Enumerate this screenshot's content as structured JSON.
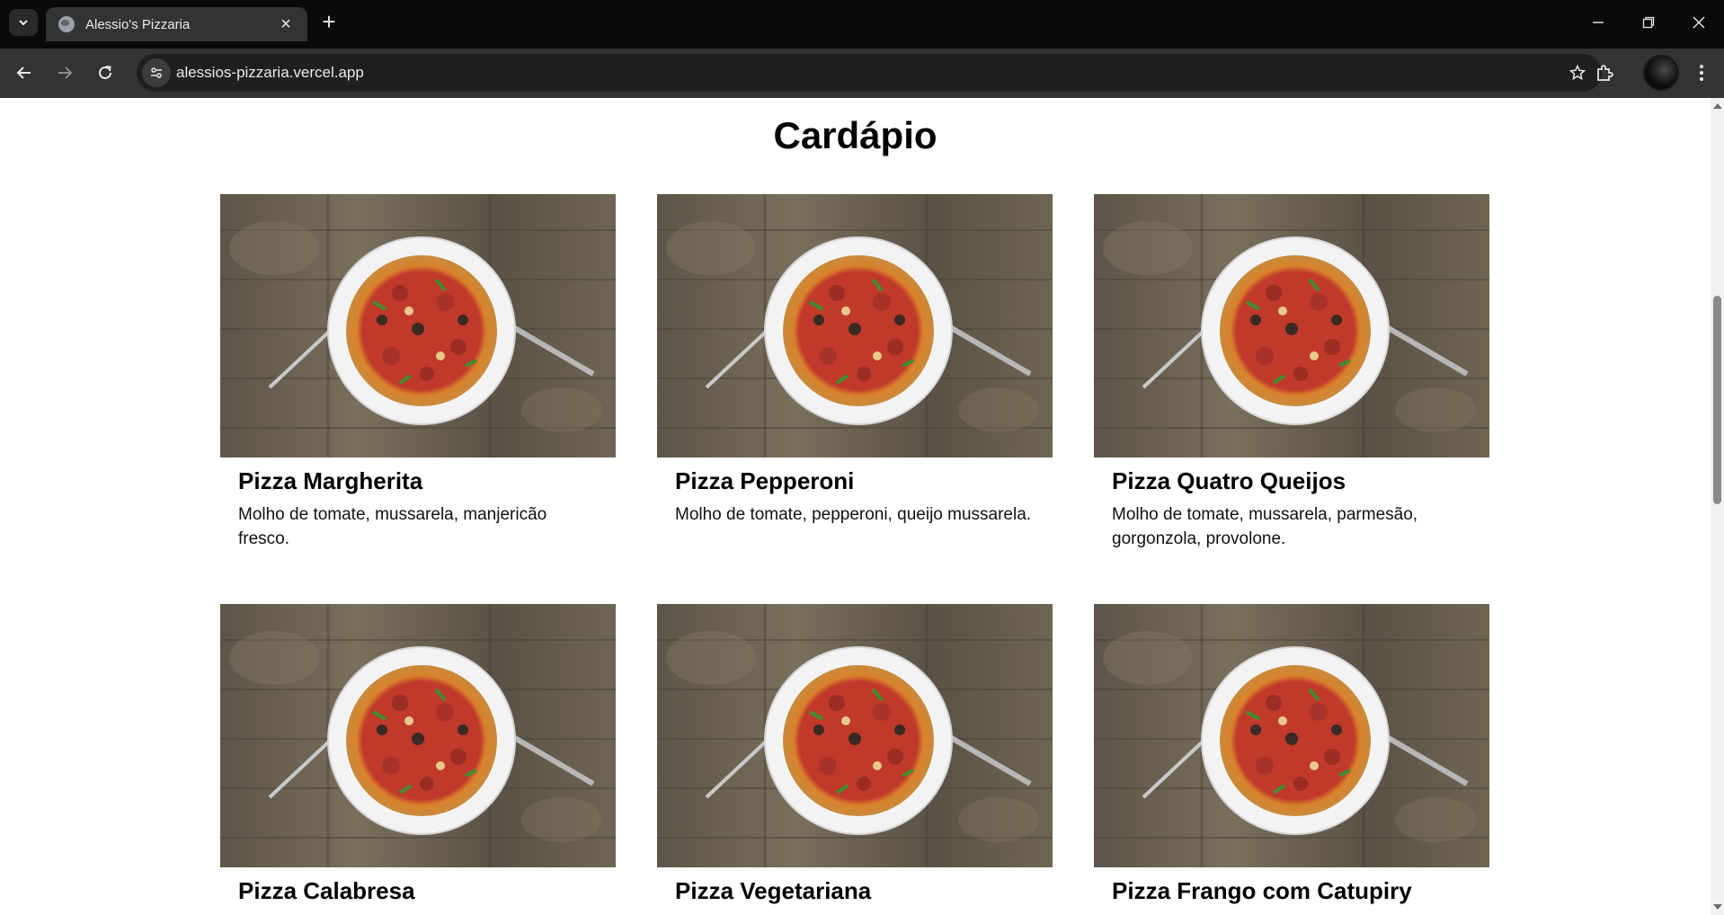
{
  "browser": {
    "tab_title": "Alessio's Pizzaria",
    "url": "alessios-pizzaria.vercel.app"
  },
  "page": {
    "title": "Cardápio"
  },
  "menu": [
    {
      "name": "Pizza Margherita",
      "description": "Molho de tomate, mussarela, manjericão fresco."
    },
    {
      "name": "Pizza Pepperoni",
      "description": "Molho de tomate, pepperoni, queijo mussarela."
    },
    {
      "name": "Pizza Quatro Queijos",
      "description": "Molho de tomate, mussarela, parmesão, gorgonzola, provolone."
    },
    {
      "name": "Pizza Calabresa",
      "description": ""
    },
    {
      "name": "Pizza Vegetariana",
      "description": ""
    },
    {
      "name": "Pizza Frango com Catupiry",
      "description": ""
    }
  ]
}
